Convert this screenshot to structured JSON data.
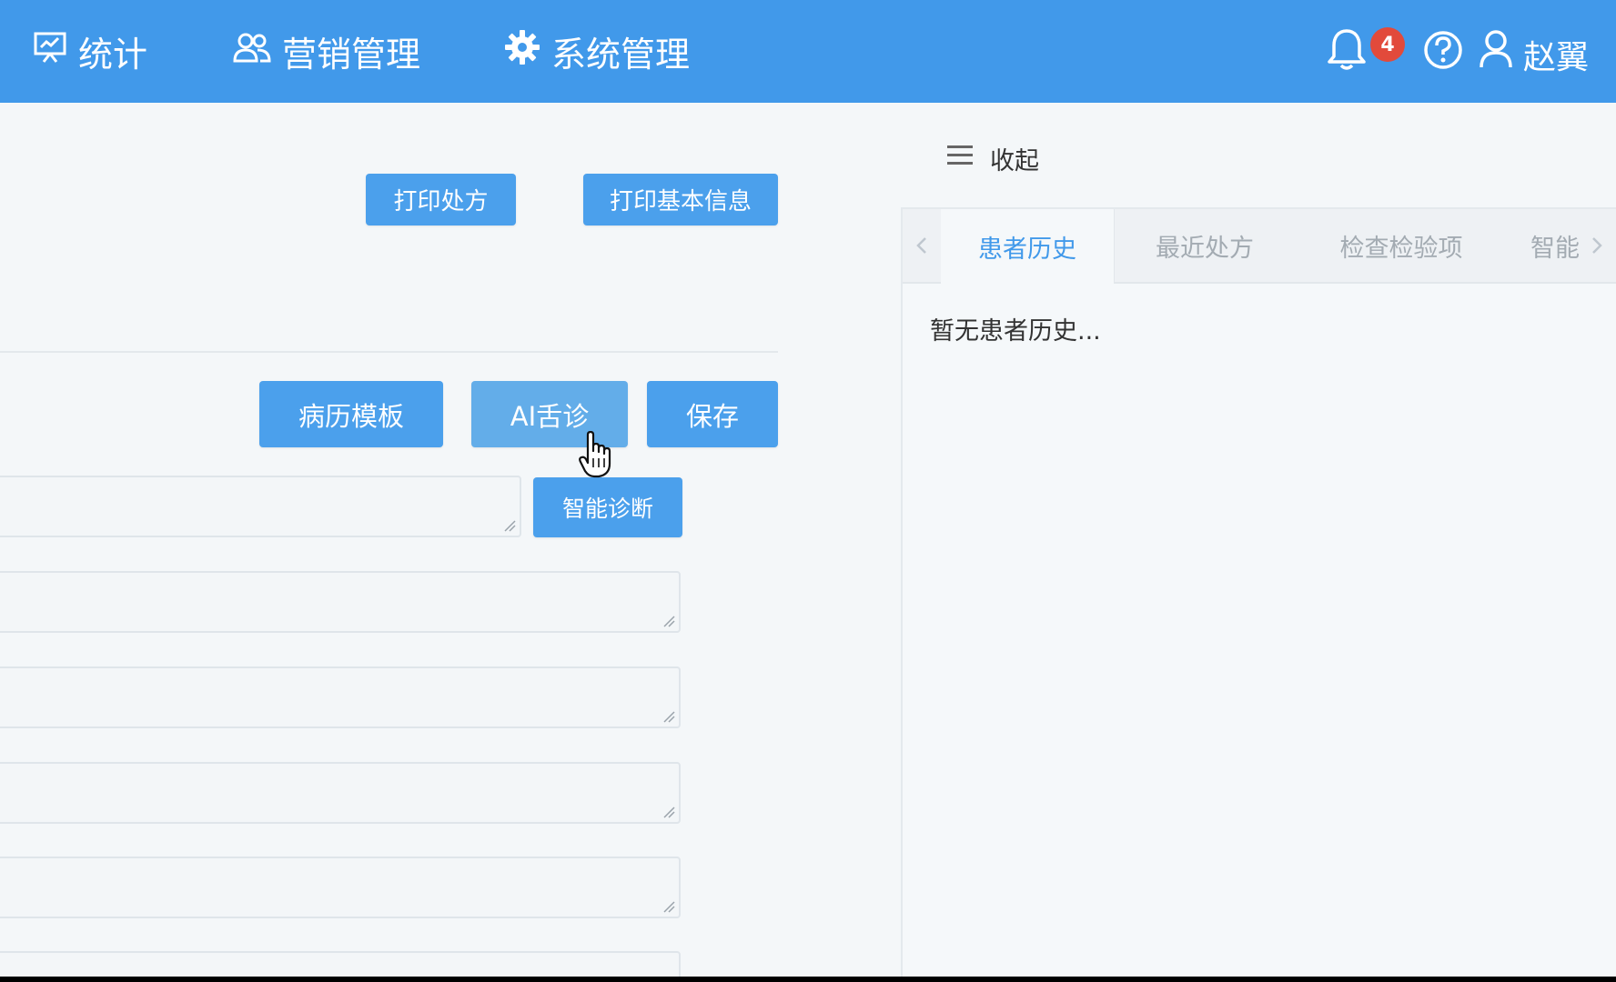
{
  "nav": {
    "items": [
      {
        "label": "统计",
        "icon": "presentation-board-icon"
      },
      {
        "label": "营销管理",
        "icon": "users-icon"
      },
      {
        "label": "系统管理",
        "icon": "gear-icon"
      }
    ],
    "notification_count": "4",
    "user_name": "赵翼"
  },
  "toolbar": {
    "print_prescription": "打印处方",
    "print_basic_info": "打印基本信息"
  },
  "actions": {
    "template": "病历模板",
    "ai_tongue": "AI舌诊",
    "save": "保存",
    "smart_diagnosis": "智能诊断"
  },
  "right_panel": {
    "collapse_label": "收起",
    "tabs": [
      {
        "label": "患者历史",
        "active": true
      },
      {
        "label": "最近处方",
        "active": false
      },
      {
        "label": "检查检验项",
        "active": false
      },
      {
        "label": "智能",
        "active": false
      }
    ],
    "empty_text": "暂无患者历史..."
  },
  "colors": {
    "primary": "#4199ea",
    "button": "#4ba0ec",
    "badge": "#e24a3b"
  }
}
